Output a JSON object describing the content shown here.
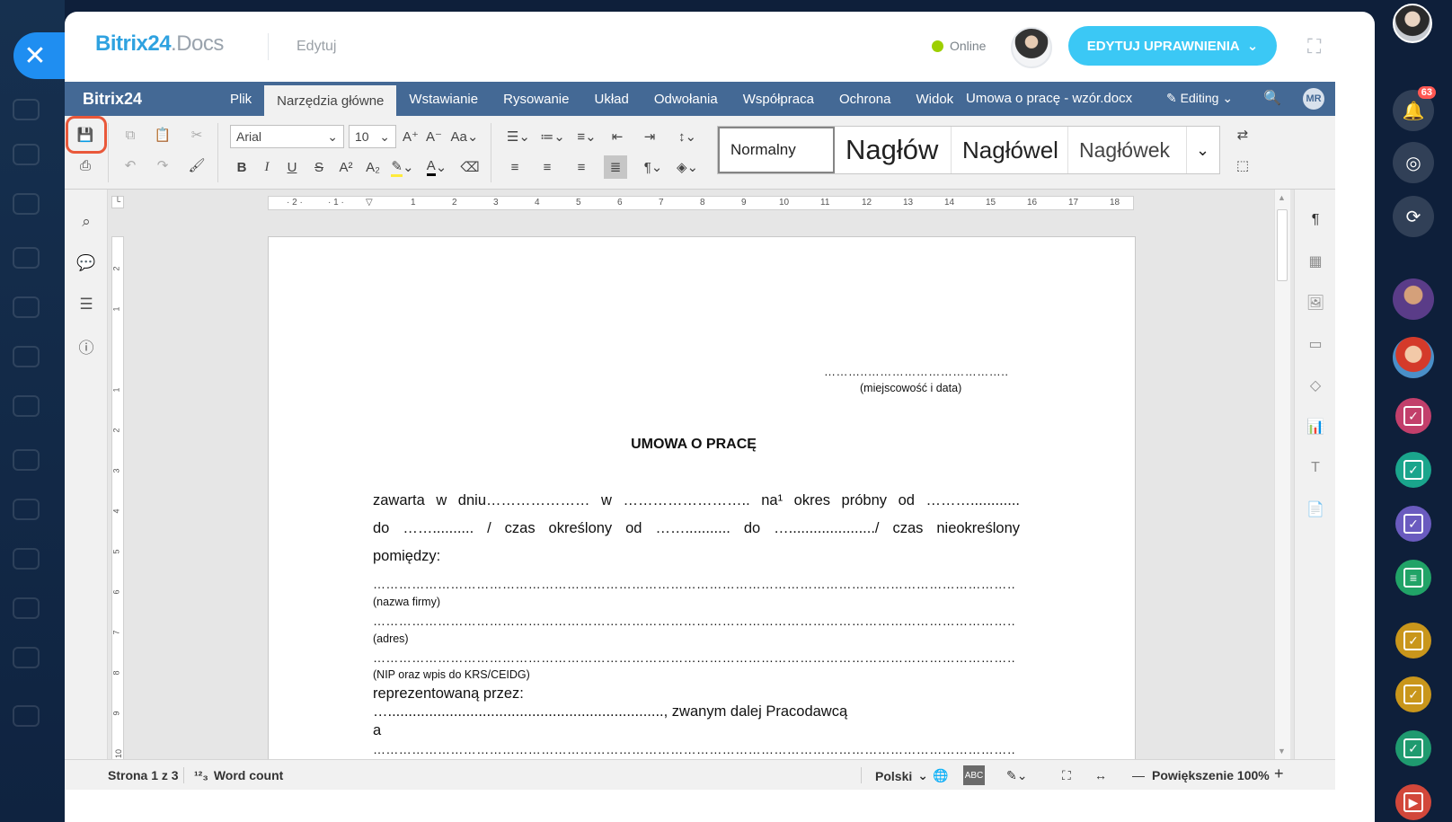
{
  "header": {
    "logo_main": "Bitrix24",
    "logo_suffix": ".Docs",
    "mode_label": "Edytuj",
    "status_label": "Online",
    "permissions_button": "EDYTUJ UPRAWNIENIA"
  },
  "tabbar": {
    "app_logo": "Bitrix24",
    "tabs": [
      "Plik",
      "Narzędzia główne",
      "Wstawianie",
      "Rysowanie",
      "Układ",
      "Odwołania",
      "Współpraca",
      "Ochrona",
      "Widok"
    ],
    "document_name": "Umowa o pracę - wzór.docx",
    "editing_label": "Editing",
    "user_initials": "MR"
  },
  "toolbar": {
    "font_name": "Arial",
    "font_size": "10",
    "styles": [
      "Normalny",
      "Nagłów",
      "Nagłówel",
      "Nagłówek"
    ]
  },
  "notifications": {
    "badge_count": "63"
  },
  "document": {
    "date_line": "………..……………………………..",
    "date_caption": "(miejscowość i data)",
    "title": "UMOWA O PRACĘ",
    "line1": "zawarta w dniu………………… w …………………….. na¹ okres próbny od ………............",
    "line2": "do …….......... / czas określony od ……........... do …...................../ czas nieokreślony",
    "line3": "pomiędzy:",
    "fill1": "…………………………………………………………………………………………………………………………………………………………",
    "caption1": "(nazwa firmy)",
    "fill2": "…………………………………………………………………………………………………………………………………………………………",
    "caption2": "(adres)",
    "fill3": "…………………………………………………………………………………………………………………………………………………………",
    "caption3": "(NIP oraz wpis do KRS/CEIDG)",
    "line4": "reprezentowaną przez:",
    "line5": "…..................................................................., zwanym dalej Pracodawcą",
    "line6": "a",
    "fill4": "…………………………………………………………………………………………………………………………………………………………"
  },
  "statusbar": {
    "page_info": "Strona 1 z 3",
    "word_count": "Word count",
    "language": "Polski",
    "zoom": "Powiększenie 100%"
  },
  "colors": {
    "accent": "#3bc8f5",
    "tabbar": "#446995",
    "highlight": "#e9583a",
    "online": "#9dcf00"
  }
}
